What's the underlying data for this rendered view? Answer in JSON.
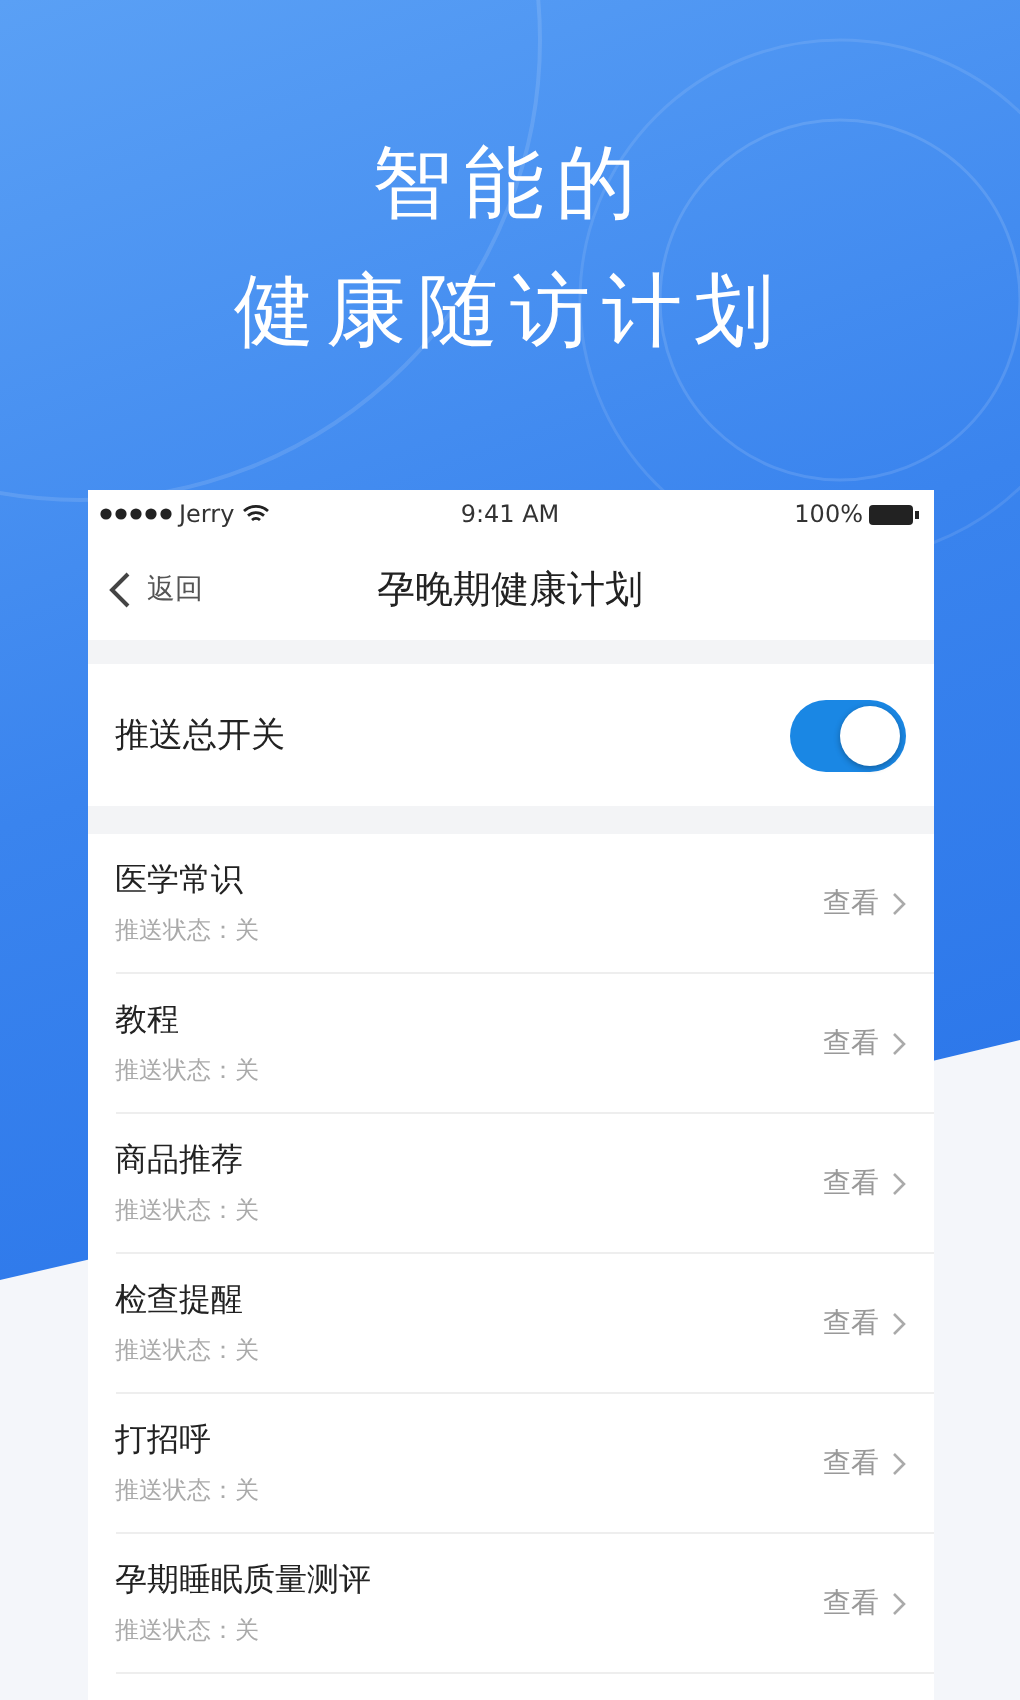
{
  "headline": [
    "智能的",
    "健康随访计划"
  ],
  "status_bar": {
    "carrier": "Jerry",
    "time": "9:41 AM",
    "battery": "100%"
  },
  "nav": {
    "back": "返回",
    "title": "孕晚期健康计划"
  },
  "master_switch": {
    "label": "推送总开关",
    "on": true
  },
  "items": [
    {
      "title": "医学常识",
      "status": "推送状态：关",
      "action": "查看"
    },
    {
      "title": "教程",
      "status": "推送状态：关",
      "action": "查看"
    },
    {
      "title": "商品推荐",
      "status": "推送状态：关",
      "action": "查看"
    },
    {
      "title": "检查提醒",
      "status": "推送状态：关",
      "action": "查看"
    },
    {
      "title": "打招呼",
      "status": "推送状态：关",
      "action": "查看"
    },
    {
      "title": "孕期睡眠质量测评",
      "status": "推送状态：关",
      "action": "查看"
    }
  ]
}
